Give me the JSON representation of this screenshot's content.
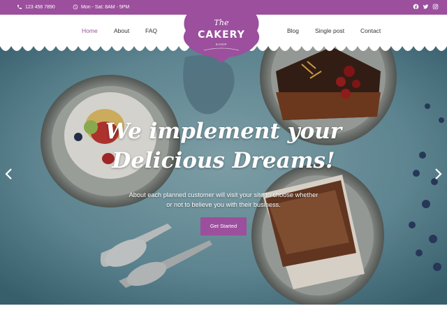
{
  "topbar": {
    "phone": "123 456 7890",
    "hours": "Mon - Sat: 8AM - 5PM",
    "social": [
      "facebook-icon",
      "twitter-icon",
      "instagram-icon"
    ]
  },
  "nav": {
    "left": [
      "Home",
      "About",
      "FAQ"
    ],
    "right": [
      "Blog",
      "Single post",
      "Contact"
    ],
    "active": "Home"
  },
  "logo": {
    "the": "The",
    "name": "CAKERY",
    "shop": "SHOP"
  },
  "hero": {
    "title_line1": "We implement your",
    "title_line2": "Delicious Dreams!",
    "subtitle_line1": "About each planned customer will visit your site to choose whether",
    "subtitle_line2": "or not to believe you with their business.",
    "cta": "Get Started"
  },
  "colors": {
    "brand": "#9b4f9c",
    "hero_bg": "#5c8e9e"
  }
}
